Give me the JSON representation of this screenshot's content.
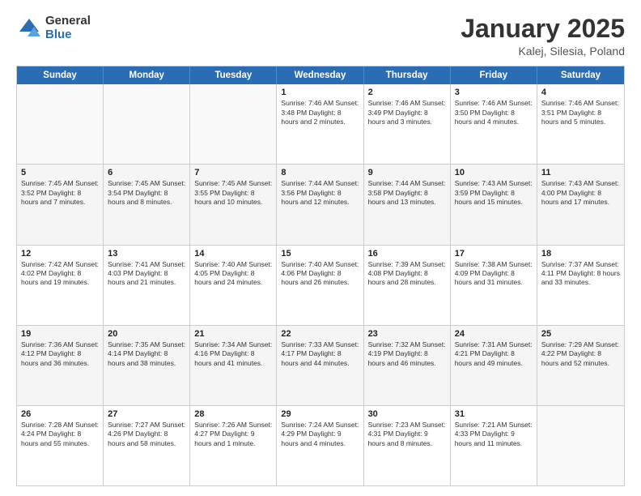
{
  "header": {
    "logo_general": "General",
    "logo_blue": "Blue",
    "title": "January 2025",
    "subtitle": "Kalej, Silesia, Poland"
  },
  "weekdays": [
    "Sunday",
    "Monday",
    "Tuesday",
    "Wednesday",
    "Thursday",
    "Friday",
    "Saturday"
  ],
  "rows": [
    [
      {
        "day": "",
        "info": ""
      },
      {
        "day": "",
        "info": ""
      },
      {
        "day": "",
        "info": ""
      },
      {
        "day": "1",
        "info": "Sunrise: 7:46 AM\nSunset: 3:48 PM\nDaylight: 8 hours\nand 2 minutes."
      },
      {
        "day": "2",
        "info": "Sunrise: 7:46 AM\nSunset: 3:49 PM\nDaylight: 8 hours\nand 3 minutes."
      },
      {
        "day": "3",
        "info": "Sunrise: 7:46 AM\nSunset: 3:50 PM\nDaylight: 8 hours\nand 4 minutes."
      },
      {
        "day": "4",
        "info": "Sunrise: 7:46 AM\nSunset: 3:51 PM\nDaylight: 8 hours\nand 5 minutes."
      }
    ],
    [
      {
        "day": "5",
        "info": "Sunrise: 7:45 AM\nSunset: 3:52 PM\nDaylight: 8 hours\nand 7 minutes."
      },
      {
        "day": "6",
        "info": "Sunrise: 7:45 AM\nSunset: 3:54 PM\nDaylight: 8 hours\nand 8 minutes."
      },
      {
        "day": "7",
        "info": "Sunrise: 7:45 AM\nSunset: 3:55 PM\nDaylight: 8 hours\nand 10 minutes."
      },
      {
        "day": "8",
        "info": "Sunrise: 7:44 AM\nSunset: 3:56 PM\nDaylight: 8 hours\nand 12 minutes."
      },
      {
        "day": "9",
        "info": "Sunrise: 7:44 AM\nSunset: 3:58 PM\nDaylight: 8 hours\nand 13 minutes."
      },
      {
        "day": "10",
        "info": "Sunrise: 7:43 AM\nSunset: 3:59 PM\nDaylight: 8 hours\nand 15 minutes."
      },
      {
        "day": "11",
        "info": "Sunrise: 7:43 AM\nSunset: 4:00 PM\nDaylight: 8 hours\nand 17 minutes."
      }
    ],
    [
      {
        "day": "12",
        "info": "Sunrise: 7:42 AM\nSunset: 4:02 PM\nDaylight: 8 hours\nand 19 minutes."
      },
      {
        "day": "13",
        "info": "Sunrise: 7:41 AM\nSunset: 4:03 PM\nDaylight: 8 hours\nand 21 minutes."
      },
      {
        "day": "14",
        "info": "Sunrise: 7:40 AM\nSunset: 4:05 PM\nDaylight: 8 hours\nand 24 minutes."
      },
      {
        "day": "15",
        "info": "Sunrise: 7:40 AM\nSunset: 4:06 PM\nDaylight: 8 hours\nand 26 minutes."
      },
      {
        "day": "16",
        "info": "Sunrise: 7:39 AM\nSunset: 4:08 PM\nDaylight: 8 hours\nand 28 minutes."
      },
      {
        "day": "17",
        "info": "Sunrise: 7:38 AM\nSunset: 4:09 PM\nDaylight: 8 hours\nand 31 minutes."
      },
      {
        "day": "18",
        "info": "Sunrise: 7:37 AM\nSunset: 4:11 PM\nDaylight: 8 hours\nand 33 minutes."
      }
    ],
    [
      {
        "day": "19",
        "info": "Sunrise: 7:36 AM\nSunset: 4:12 PM\nDaylight: 8 hours\nand 36 minutes."
      },
      {
        "day": "20",
        "info": "Sunrise: 7:35 AM\nSunset: 4:14 PM\nDaylight: 8 hours\nand 38 minutes."
      },
      {
        "day": "21",
        "info": "Sunrise: 7:34 AM\nSunset: 4:16 PM\nDaylight: 8 hours\nand 41 minutes."
      },
      {
        "day": "22",
        "info": "Sunrise: 7:33 AM\nSunset: 4:17 PM\nDaylight: 8 hours\nand 44 minutes."
      },
      {
        "day": "23",
        "info": "Sunrise: 7:32 AM\nSunset: 4:19 PM\nDaylight: 8 hours\nand 46 minutes."
      },
      {
        "day": "24",
        "info": "Sunrise: 7:31 AM\nSunset: 4:21 PM\nDaylight: 8 hours\nand 49 minutes."
      },
      {
        "day": "25",
        "info": "Sunrise: 7:29 AM\nSunset: 4:22 PM\nDaylight: 8 hours\nand 52 minutes."
      }
    ],
    [
      {
        "day": "26",
        "info": "Sunrise: 7:28 AM\nSunset: 4:24 PM\nDaylight: 8 hours\nand 55 minutes."
      },
      {
        "day": "27",
        "info": "Sunrise: 7:27 AM\nSunset: 4:26 PM\nDaylight: 8 hours\nand 58 minutes."
      },
      {
        "day": "28",
        "info": "Sunrise: 7:26 AM\nSunset: 4:27 PM\nDaylight: 9 hours\nand 1 minute."
      },
      {
        "day": "29",
        "info": "Sunrise: 7:24 AM\nSunset: 4:29 PM\nDaylight: 9 hours\nand 4 minutes."
      },
      {
        "day": "30",
        "info": "Sunrise: 7:23 AM\nSunset: 4:31 PM\nDaylight: 9 hours\nand 8 minutes."
      },
      {
        "day": "31",
        "info": "Sunrise: 7:21 AM\nSunset: 4:33 PM\nDaylight: 9 hours\nand 11 minutes."
      },
      {
        "day": "",
        "info": ""
      }
    ]
  ]
}
